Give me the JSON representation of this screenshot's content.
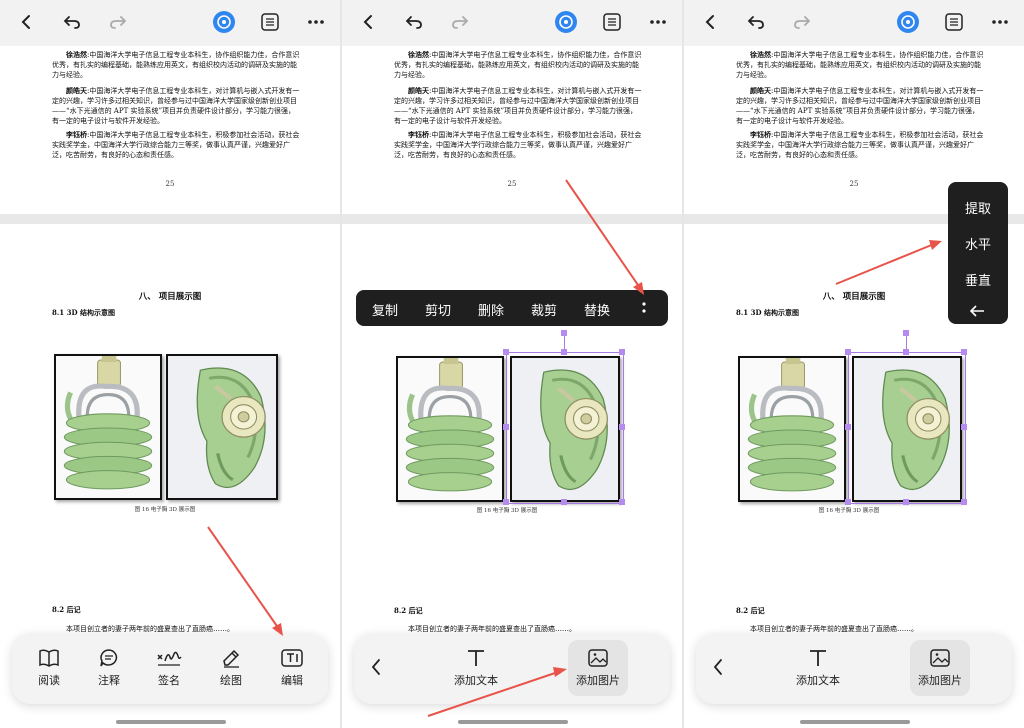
{
  "doc": {
    "para1_name": "徐浩然",
    "para1_text": ":中国海洋大学电子信息工程专业本科生，协作组织能力佳，合作意识优秀，有扎实的编程基础，能熟练应用英文，有组织校内活动的调研及实施的能力与经验。",
    "para2_name": "颜皓天",
    "para2_text": ":中国海洋大学电子信息工程专业本科生，对计算机与嵌入式开发有一定的兴趣，学习许多过相关知识，曾经参与过中国海洋大学国家级创新创业项目——“水下光通信的 APT 实验系统”项目并负责硬件设计部分，学习能力很强，有一定的电子设计与软件开发经验。",
    "para3_name": "李钰桥",
    "para3_text": ":中国海洋大学电子信息工程专业本科生，积极参加社会活动，获社会实践奖学金，中国海洋大学行政综合能力三等奖，做事认真严谨，兴趣爱好广泛，吃苦耐劳，有良好的心态和责任感。",
    "page_number": "25",
    "section_title": "八、 项目展示图",
    "subsection_1": "8.1  3D 结构示意图",
    "figure_caption": "图 16  电子胸 3D 展示图",
    "subsection_2": "8.2  后记",
    "afterword": "本项目创立者的妻子两年前的盛夏查出了直肠癌……。"
  },
  "bottom_toolbar": {
    "read": "阅读",
    "annotate": "注释",
    "sign": "签名",
    "draw": "绘图",
    "edit": "编辑"
  },
  "edit_toolbar": {
    "add_text": "添加文本",
    "add_image": "添加图片"
  },
  "context_menu": {
    "copy": "复制",
    "cut": "剪切",
    "delete": "删除",
    "crop": "裁剪",
    "replace": "替换"
  },
  "more_menu": {
    "extract": "提取",
    "horizontal": "水平",
    "vertical": "垂直"
  },
  "colors": {
    "arrow": "#e8534a",
    "selection": "#a77be6",
    "ai_icon": "#2f86f0"
  }
}
